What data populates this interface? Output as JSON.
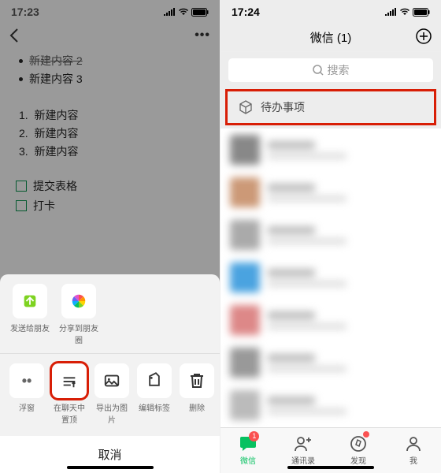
{
  "left": {
    "status_time": "17:23",
    "note": {
      "bullet_strike": "新建内容 2",
      "bullet_item": "新建内容 3",
      "ol": [
        "新建内容",
        "新建内容",
        "新建内容"
      ],
      "check1": "提交表格",
      "check2": "打卡"
    },
    "share_row": [
      {
        "name": "send-friend",
        "label": "发送给朋友"
      },
      {
        "name": "share-moments",
        "label": "分享到朋友圈"
      }
    ],
    "action_row": [
      {
        "name": "float",
        "label": "浮窗"
      },
      {
        "name": "pin-in-chat",
        "label": "在聊天中置顶",
        "hl": true
      },
      {
        "name": "export-image",
        "label": "导出为图片"
      },
      {
        "name": "edit-tag",
        "label": "编辑标签"
      },
      {
        "name": "delete",
        "label": "删除"
      }
    ],
    "cancel": "取消"
  },
  "right": {
    "status_time": "17:24",
    "title": "微信 (1)",
    "search_placeholder": "搜索",
    "pinned_label": "待办事项",
    "tabs": [
      {
        "name": "chats",
        "label": "微信",
        "badge": "1",
        "active": true
      },
      {
        "name": "contacts",
        "label": "通讯录"
      },
      {
        "name": "discover",
        "label": "发现",
        "dot": true
      },
      {
        "name": "me",
        "label": "我"
      }
    ]
  }
}
